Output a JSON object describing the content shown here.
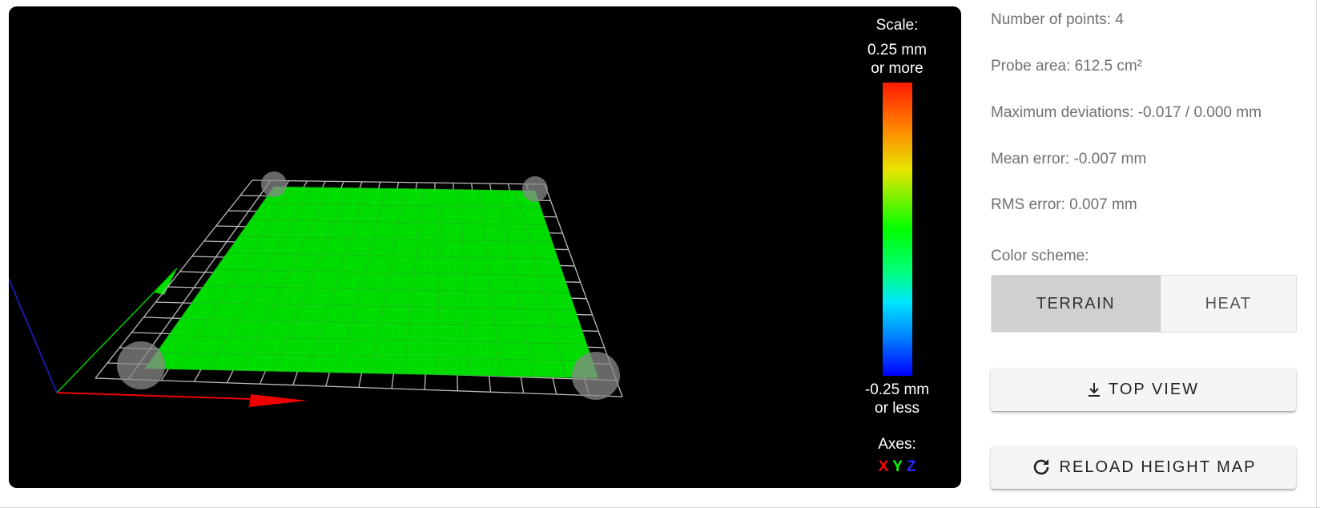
{
  "viewer": {
    "scale_title": "Scale:",
    "scale_max_line1": "0.25 mm",
    "scale_max_line2": "or more",
    "scale_min_line1": "-0.25 mm",
    "scale_min_line2": "or less",
    "axes_title": "Axes:",
    "axis_x": "X",
    "axis_y": "Y",
    "axis_z": "Z",
    "mesh_color": "#00e000",
    "grid_color": "#c0c0c0"
  },
  "stats": {
    "points": "Number of points: 4",
    "area": "Probe area: 612.5 cm²",
    "deviations": "Maximum deviations: -0.017 / 0.000 mm",
    "mean": "Mean error: -0.007 mm",
    "rms": "RMS error: 0.007 mm"
  },
  "color_scheme": {
    "label": "Color scheme:",
    "options": [
      "TERRAIN",
      "HEAT"
    ],
    "selected": "TERRAIN"
  },
  "actions": {
    "top_view": "TOP VIEW",
    "reload": "RELOAD HEIGHT MAP"
  }
}
